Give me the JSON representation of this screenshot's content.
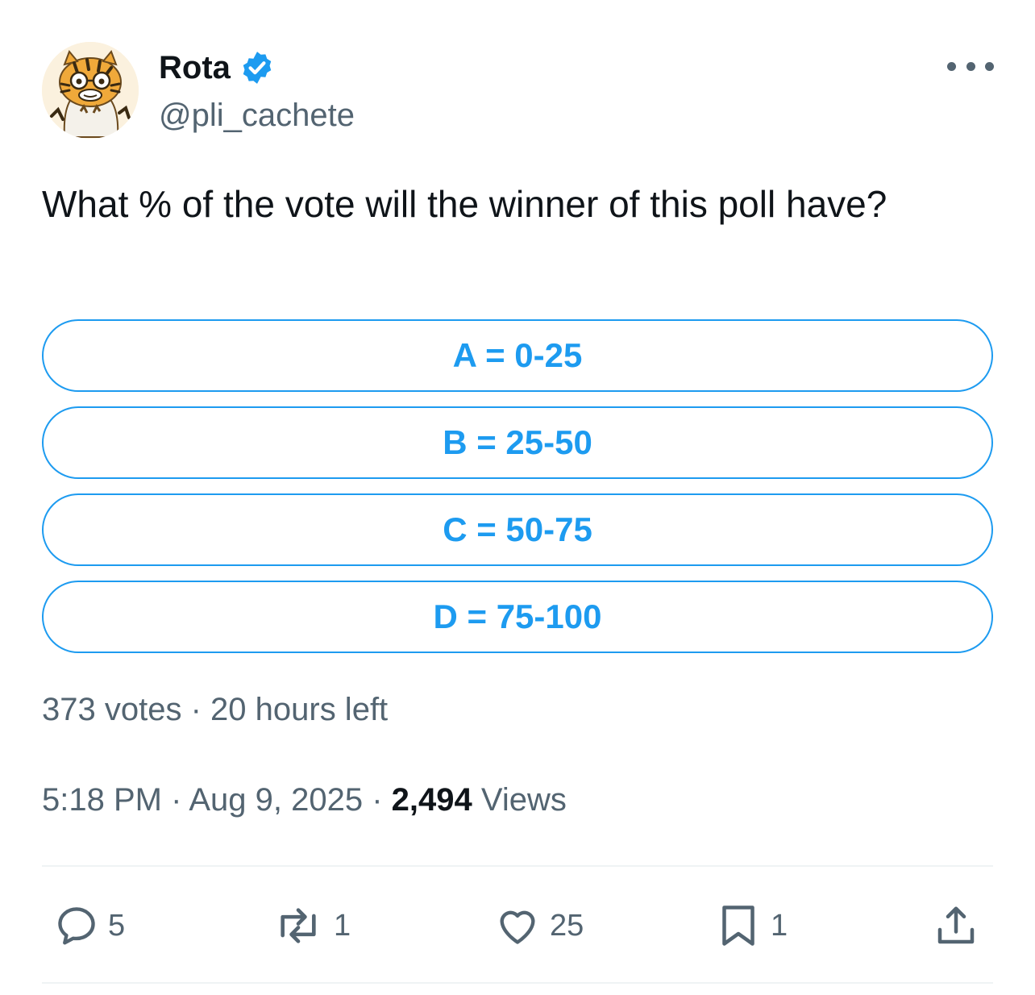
{
  "author": {
    "name": "Rota",
    "handle": "@pli_cachete",
    "verified": true
  },
  "tweet": {
    "text": "What % of the vote will the winner of this poll have?"
  },
  "poll": {
    "options": [
      {
        "label": "A = 0-25"
      },
      {
        "label": "B = 25-50"
      },
      {
        "label": "C = 50-75"
      },
      {
        "label": "D = 75-100"
      }
    ],
    "votes": "373 votes",
    "time_left": "20 hours left"
  },
  "meta": {
    "time": "5:18 PM",
    "date": "Aug 9, 2025",
    "views_count": "2,494",
    "views_label": "Views"
  },
  "actions": {
    "replies": "5",
    "reposts": "1",
    "likes": "25",
    "bookmarks": "1"
  },
  "colors": {
    "accent": "#1d9bf0",
    "secondary_text": "#536471",
    "primary_text": "#0f1419"
  },
  "icons": [
    "verified-badge-icon",
    "more-icon",
    "reply-icon",
    "repost-icon",
    "like-icon",
    "bookmark-icon",
    "share-icon"
  ]
}
